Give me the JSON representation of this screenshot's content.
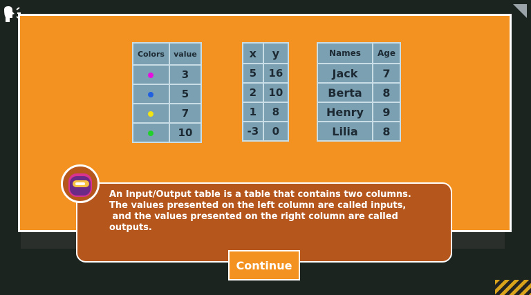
{
  "colors": {
    "panel": "#f39220",
    "table_bg": "#7aa0b2",
    "dialog_bg": "#b5571c",
    "magenta": "#e60fe0",
    "blue": "#1f5fe0",
    "yellow": "#f2e313",
    "green": "#20d12a"
  },
  "tables": {
    "colors_table": {
      "headers": [
        "Colors",
        "value"
      ],
      "rows": [
        {
          "color": "magenta",
          "value": "3"
        },
        {
          "color": "blue",
          "value": "5"
        },
        {
          "color": "yellow",
          "value": "7"
        },
        {
          "color": "green",
          "value": "10"
        }
      ]
    },
    "xy_table": {
      "headers": [
        "x",
        "y"
      ],
      "rows": [
        {
          "x": "5",
          "y": "16"
        },
        {
          "x": "2",
          "y": "10"
        },
        {
          "x": "1",
          "y": "8"
        },
        {
          "x": "-3",
          "y": "0"
        }
      ]
    },
    "names_table": {
      "headers": [
        "Names",
        "Age"
      ],
      "rows": [
        {
          "name": "Jack",
          "age": "7"
        },
        {
          "name": "Berta",
          "age": "8"
        },
        {
          "name": "Henry",
          "age": "9"
        },
        {
          "name": "Lilia",
          "age": "8"
        }
      ]
    }
  },
  "dialog": {
    "lines": [
      "An Input/Output table is a table that contains two columns.",
      "The values presented on the left column are called inputs,",
      " and the values presented on the right column are called",
      "outputs."
    ]
  },
  "continue_label": "Continue",
  "icons": {
    "sound": "speaker-head-icon",
    "corner": "corner-triangle-icon",
    "avatar": "robot-character-icon"
  }
}
